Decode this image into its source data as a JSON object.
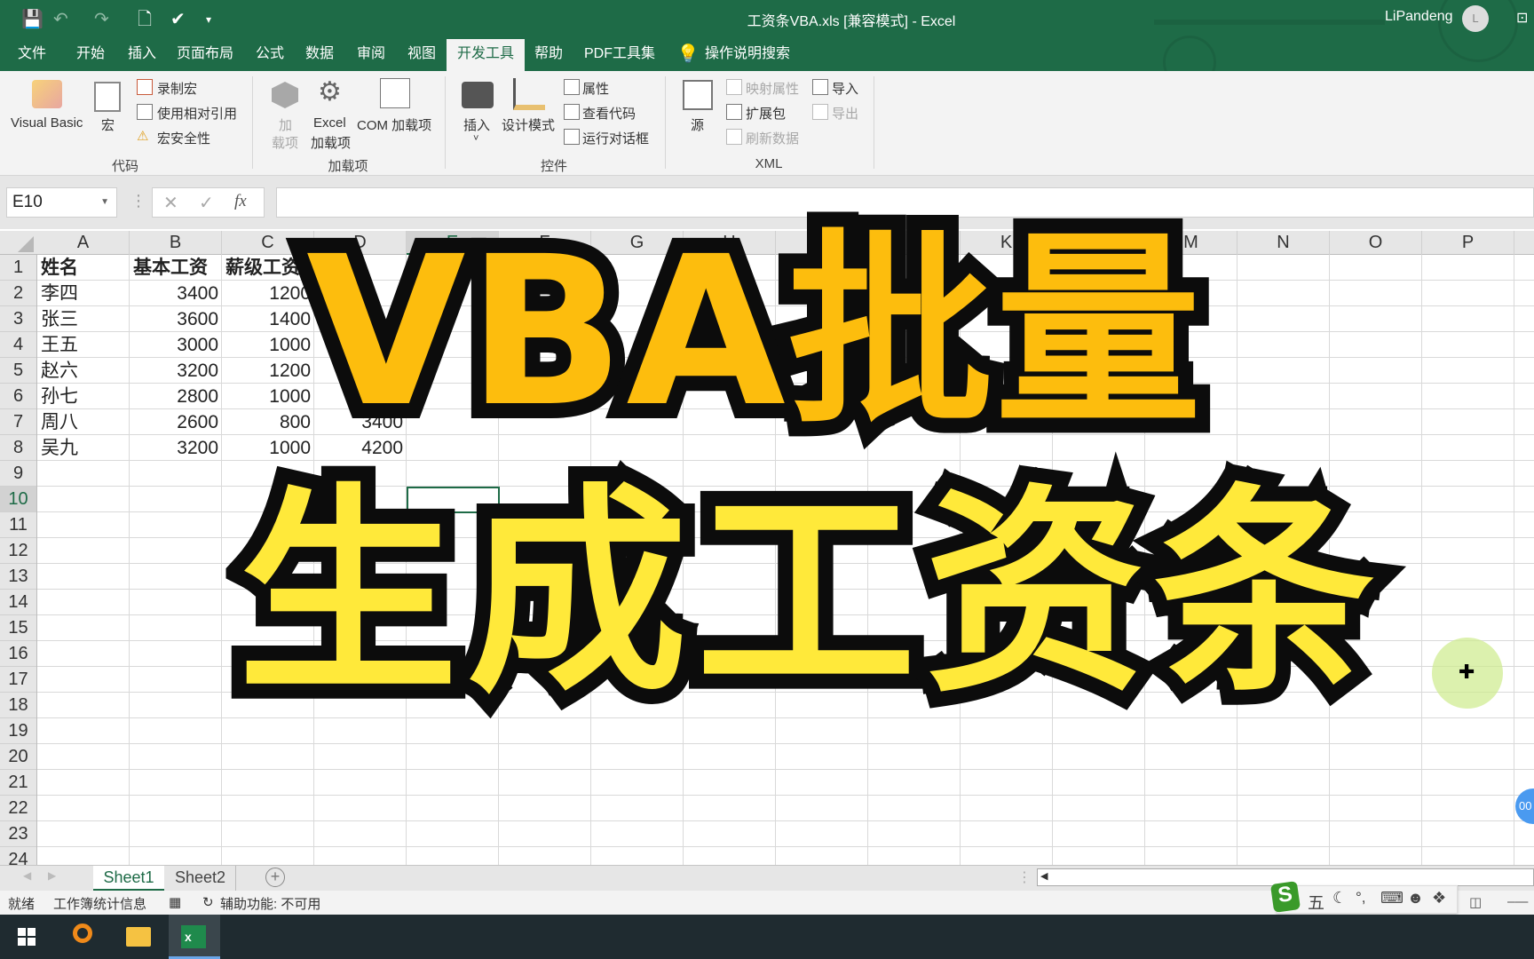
{
  "title_bar": {
    "title": "工资条VBA.xls  [兼容模式]  -  Excel",
    "user": "LiPandeng",
    "avatar_initial": "L",
    "quick_access": [
      "save-icon",
      "undo-icon",
      "redo-icon",
      "print-preview-icon",
      "check-icon",
      "customize-icon"
    ]
  },
  "tabs": [
    "文件",
    "开始",
    "插入",
    "页面布局",
    "公式",
    "数据",
    "审阅",
    "视图",
    "开发工具",
    "帮助",
    "PDF工具集",
    "操作说明搜索"
  ],
  "active_tab": "开发工具",
  "ribbon": {
    "code": {
      "label": "代码",
      "visual_basic": "Visual Basic",
      "macros": "宏",
      "record": "录制宏",
      "relative": "使用相对引用",
      "security": "宏安全性"
    },
    "addins": {
      "label": "加载项",
      "addins_a": "加",
      "addins_b": "载项",
      "excel_a": "Excel",
      "excel_b": "加载项",
      "com": "COM 加载项"
    },
    "controls": {
      "label": "控件",
      "insert": "插入",
      "design": "设计模式",
      "properties": "属性",
      "view_code": "查看代码",
      "run_dialog": "运行对话框"
    },
    "xml": {
      "label": "XML",
      "source": "源",
      "map_props": "映射属性",
      "expansion": "扩展包",
      "refresh": "刷新数据",
      "import": "导入",
      "export": "导出"
    }
  },
  "formula_bar": {
    "name_box": "E10",
    "formula": "",
    "fx": "fx"
  },
  "columns": [
    "A",
    "B",
    "C",
    "D",
    "E",
    "F",
    "G",
    "H",
    "I",
    "J",
    "K",
    "L",
    "M",
    "N",
    "O",
    "P"
  ],
  "selected_cell": {
    "column": "E",
    "row": 10
  },
  "rows_visible": 24,
  "table": [
    [
      "姓名",
      "基本工资",
      "薪级工资",
      ""
    ],
    [
      "李四",
      "3400",
      "1200",
      ""
    ],
    [
      "张三",
      "3600",
      "1400",
      ""
    ],
    [
      "王五",
      "3000",
      "1000",
      ""
    ],
    [
      "赵六",
      "3200",
      "1200",
      ""
    ],
    [
      "孙七",
      "2800",
      "1000",
      ""
    ],
    [
      "周八",
      "2600",
      "800",
      "3400"
    ],
    [
      "吴九",
      "3200",
      "1000",
      "4200"
    ]
  ],
  "overlay": {
    "line1": "VBA批量",
    "line2": "生成工资条",
    "color1": "#fdbd0d",
    "color2": "#ffe93a"
  },
  "sheets": [
    "Sheet1",
    "Sheet2"
  ],
  "active_sheet": "Sheet1",
  "status": {
    "ready": "就绪",
    "stats": "工作簿统计信息",
    "accessibility": "辅助功能: 不可用"
  },
  "ime": {
    "mode": "五"
  },
  "bubble": "00",
  "colors": {
    "excel_green": "#1e6b47",
    "taskbar": "#1f2b30"
  }
}
